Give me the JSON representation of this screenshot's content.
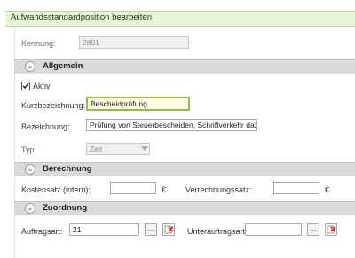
{
  "window": {
    "title": "Aufwandsstandardposition bearbeiten"
  },
  "fields": {
    "kennung": {
      "label": "Kennung:",
      "value": "2801"
    },
    "kurzbezeichnung": {
      "label": "Kurzbezeichnung:",
      "value": "Bescheidprüfung"
    },
    "bezeichnung": {
      "label": "Bezeichnung:",
      "value": "Prüfung von Steuerbescheiden, Schriftverkehr dazu"
    },
    "typ": {
      "label": "Typ:",
      "value": "Zeit"
    },
    "kostensatz": {
      "label": "Kostensatz (intern):",
      "value": "",
      "unit": "€"
    },
    "verrechnungssatz": {
      "label": "Verrechnungssatz:",
      "value": "",
      "unit": "€"
    },
    "auftragsart": {
      "label": "Auftragsart:",
      "value": "21"
    },
    "unterauftragsart": {
      "label": "Unterauftragsart:",
      "value": ""
    }
  },
  "sections": {
    "allgemein": "Allgemein",
    "berechnung": "Berechnung",
    "zuordnung": "Zuordnung"
  },
  "checkbox": {
    "aktiv": {
      "label": "Aktiv",
      "checked": true
    }
  },
  "buttons": {
    "browse": "...",
    "clear_icon": "delete-icon"
  },
  "icons": {
    "chevron": "chevron-down-icon",
    "check": "check-icon",
    "dropdown": "dropdown-arrow-icon"
  },
  "colors": {
    "title_bg": "#e8f4d8",
    "section_bg": "#d9d9d9",
    "focus_border": "#8fc04a",
    "delete_red": "#d03030"
  }
}
